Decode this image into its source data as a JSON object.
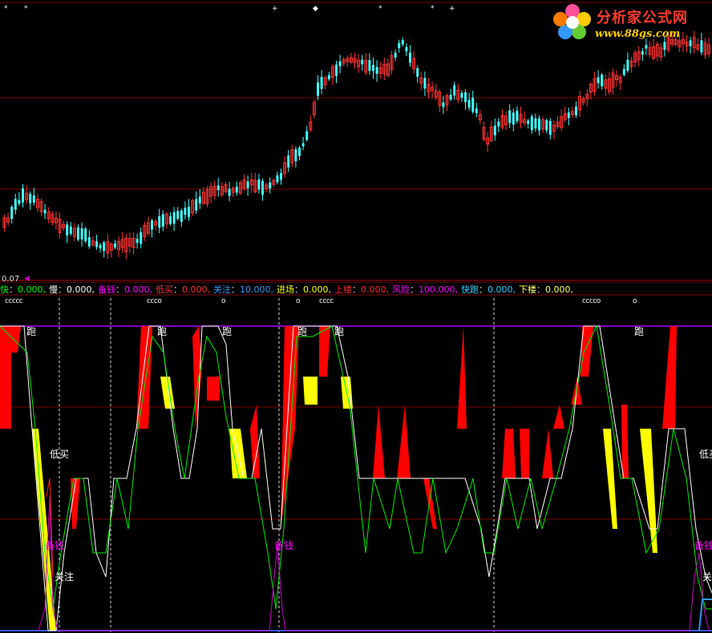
{
  "logo": {
    "title": "分析家公式网",
    "url": "www.88gs.com",
    "icon": "flower-logo-icon"
  },
  "axis": {
    "value_label": "0.07",
    "arrow": "◀"
  },
  "legend": [
    {
      "name": "快",
      "value": "0.000",
      "color": "#00ff00"
    },
    {
      "name": "慢",
      "value": "0.000",
      "color": "#ffffff"
    },
    {
      "name": "备钱",
      "value": "0.000",
      "color": "#ff00ff"
    },
    {
      "name": "低买",
      "value": "0.000",
      "color": "#ff3030"
    },
    {
      "name": "关注",
      "value": "10.000",
      "color": "#3399ff"
    },
    {
      "name": "进场",
      "value": "0.000",
      "color": "#ffff00"
    },
    {
      "name": "上楼",
      "value": "0.000",
      "color": "#ff2020"
    },
    {
      "name": "风险",
      "value": "100.000",
      "color": "#ff00ff"
    },
    {
      "name": "快跑",
      "value": "0.000",
      "color": "#33ccff"
    },
    {
      "name": "下楼",
      "value": "0.000",
      "color": "#ffff66"
    }
  ],
  "separator": "：",
  "top_markers": [
    "*",
    "*",
    "+",
    "◆",
    "*",
    "*",
    "+"
  ],
  "ccc_markers": [
    "ccccc",
    "ccco",
    "o",
    "o",
    "cccc",
    "cccco",
    "o"
  ],
  "run_labels": [
    "跑",
    "跑",
    "跑",
    "跑",
    "跑",
    "跑"
  ],
  "signal_labels": {
    "low_buy_1": "低买",
    "low_buy_2": "低买",
    "prepare_money_1": "备钱",
    "prepare_money_2": "备钱",
    "prepare_money_3": "备钱",
    "watch_1": "关注",
    "watch_2": "关"
  },
  "colors": {
    "up_candle": "#ff3333",
    "down_candle": "#44ffff",
    "grid_line": "#7a0000",
    "panel_border": "#aa0000",
    "risk_line": "#aa00ff",
    "fill_red": "#ff0000",
    "fill_yellow": "#ffff00"
  }
}
